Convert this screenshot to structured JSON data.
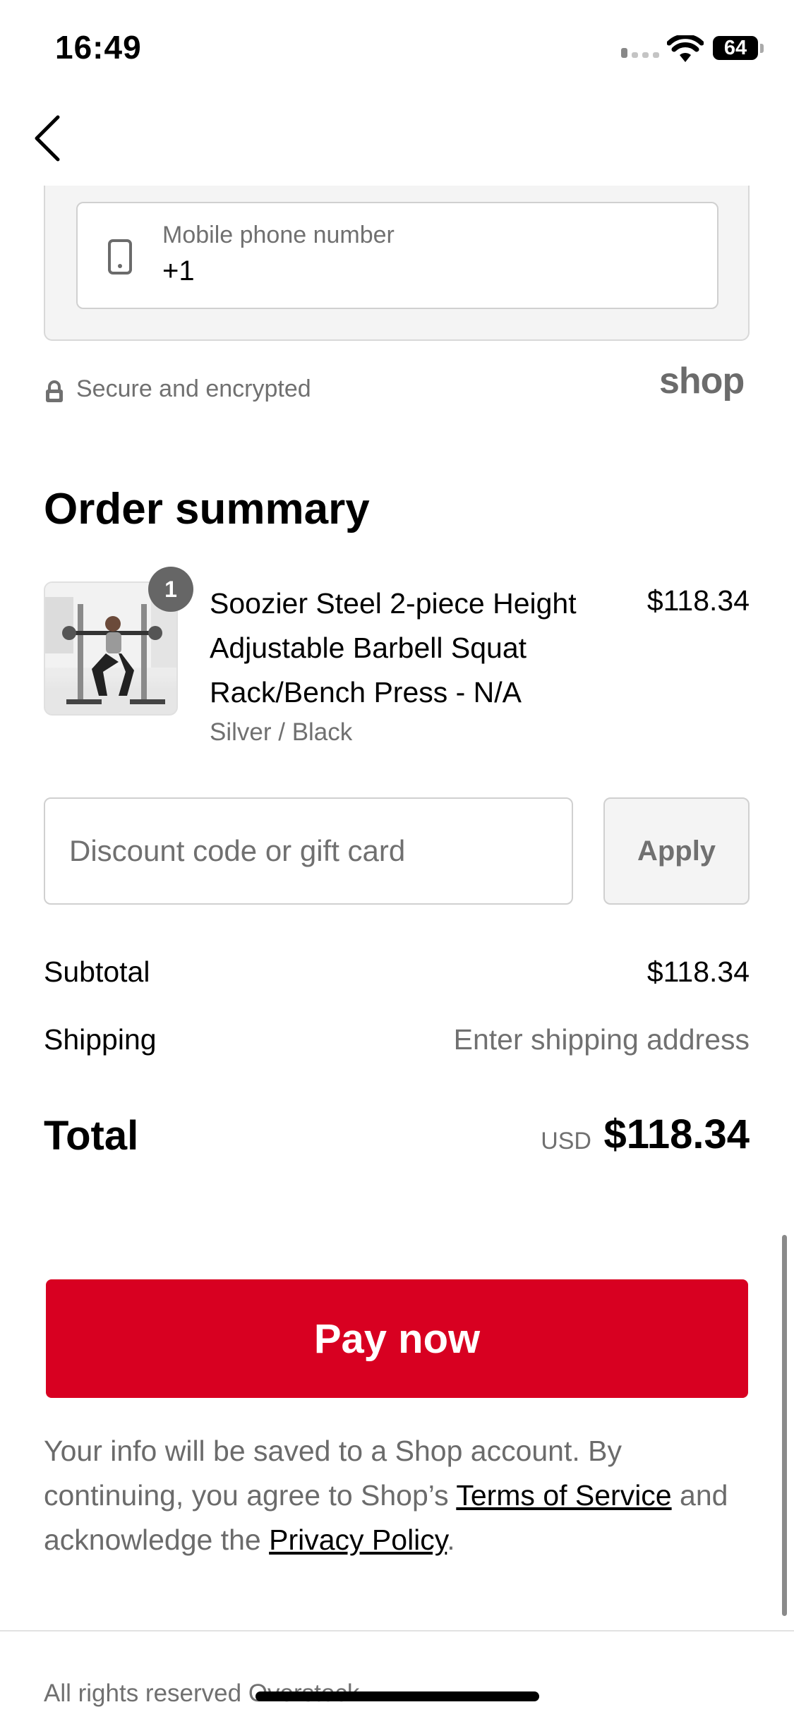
{
  "status_bar": {
    "time": "16:49",
    "battery": "64"
  },
  "contact": {
    "phone_label": "Mobile phone number",
    "phone_value": "+1"
  },
  "security": {
    "text": "Secure and encrypted",
    "brand": "shop"
  },
  "order_summary": {
    "title": "Order summary",
    "item": {
      "quantity": "1",
      "name": "Soozier Steel 2-piece Height Adjustable Barbell Squat Rack/Bench Press - N/A",
      "price": "$118.34",
      "variant": "Silver / Black"
    },
    "discount": {
      "placeholder": "Discount code or gift card",
      "apply_label": "Apply"
    },
    "subtotal": {
      "label": "Subtotal",
      "value": "$118.34"
    },
    "shipping": {
      "label": "Shipping",
      "value": "Enter shipping address"
    },
    "total": {
      "label": "Total",
      "currency": "USD",
      "value": "$118.34"
    }
  },
  "pay_button": {
    "label": "Pay now"
  },
  "legal": {
    "text_1": "Your info will be saved to a Shop account. By continuing, you agree to Shop’s ",
    "terms": "Terms of Service",
    "text_2": " and acknowledge the ",
    "privacy": "Privacy Policy",
    "text_3": "."
  },
  "footer": {
    "text": "All rights reserved Overstock"
  },
  "colors": {
    "accent": "#d80021",
    "muted_text": "#707070",
    "panel_bg": "#f4f4f4"
  }
}
